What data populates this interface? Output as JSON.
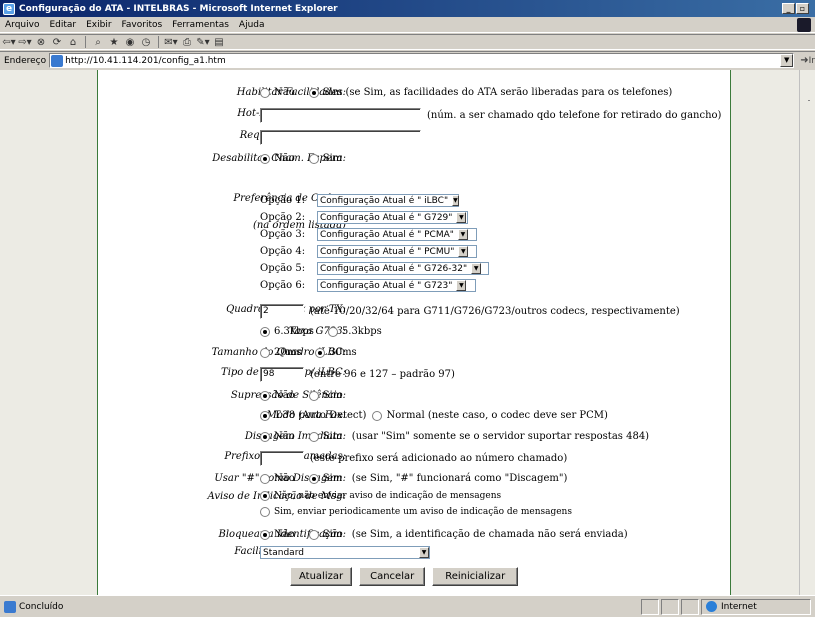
{
  "window": {
    "title": "Configuração do ATA - INTELBRAS - Microsoft Internet Explorer",
    "minimize": "_",
    "maximize": "▫"
  },
  "menu": [
    "Arquivo",
    "Editar",
    "Exibir",
    "Favoritos",
    "Ferramentas",
    "Ajuda"
  ],
  "address": {
    "label": "Endereço",
    "url": "http://10.41.114.201/config_a1.htm",
    "go": "Ir"
  },
  "form": {
    "habilitar_facilidades": {
      "label": "Habilitar Facilidades:",
      "opt_no": "Não",
      "opt_yes": "Sim (se Sim, as facilidades do ATA serão liberadas para os telefones)",
      "selected": "yes"
    },
    "hotline": {
      "label": "Hot-Line Imediato p/:",
      "value": "",
      "note": "(núm. a ser chamado qdo telefone for retirado do gancho)"
    },
    "proxy": {
      "label": "Requisição de Proxy:",
      "value": ""
    },
    "desabilitar_espera": {
      "label": "Desabilitar Cham. Espera:",
      "opt_no": "Não",
      "opt_yes": "Sim",
      "selected": "no"
    },
    "codec": {
      "label": "Preferência de Codec:",
      "sublabel": "(na ordem listada)",
      "options": [
        {
          "label": "Opção 1:",
          "value": "Configuração Atual é \" iLBC\""
        },
        {
          "label": "Opção 2:",
          "value": "Configuração Atual é \" G729\""
        },
        {
          "label": "Opção 3:",
          "value": "Configuração Atual é \" PCMA\""
        },
        {
          "label": "Opção 4:",
          "value": "Configuração Atual é \" PCMU\""
        },
        {
          "label": "Opção 5:",
          "value": "Configuração Atual é \" G726-32\""
        },
        {
          "label": "Opção 6:",
          "value": "Configuração Atual é \" G723\""
        }
      ]
    },
    "quadros_voz": {
      "label": "Quadros de Voz por TX:",
      "value": "2",
      "note": "(até 10/20/32/64 para G711/G726/G723/outros codecs, respectivamente)"
    },
    "taxa_g723": {
      "label": "Taxa G723:",
      "opt_a": "6.3kbps",
      "opt_b": "5.3kbps",
      "selected": "a"
    },
    "quadro_ilbc": {
      "label": "Tamanho do Quadro iLBC:",
      "opt_a": "20ms",
      "opt_b": "30ms",
      "selected": "b"
    },
    "payload_ilbc": {
      "label": "Tipo de Payload p/ iLBC:",
      "value": "98",
      "note": "(entre 96 e 127 – padrão 97)"
    },
    "supressao": {
      "label": "Supressão de Silêncio:",
      "opt_no": "Não",
      "opt_yes": "Sim",
      "selected": "no"
    },
    "modo_fax": {
      "label": "Modo para Fax:",
      "opt_a": "T.38 (Auto Detect)",
      "opt_b": "Normal (neste caso, o codec deve ser PCM)",
      "selected": "a"
    },
    "discagem_imediata": {
      "label": "Discagem Imediata:",
      "opt_no": "Não",
      "opt_yes": "Sim   (usar \"Sim\" somente se o servidor suportar respostas 484)",
      "selected": "no"
    },
    "prefixo": {
      "label": "Prefixo para Chamadas:",
      "value": "",
      "note": "(este prefixo será adicionado ao número chamado)"
    },
    "usar_hash": {
      "label": "Usar \"#\" como Discagem:",
      "opt_no": "Não",
      "opt_yes": "Sim   (se Sim, \"#\" funcionará como \"Discagem\")",
      "selected": "yes"
    },
    "aviso_msg": {
      "label": "Aviso de Indicação de Msg:",
      "opt_a": "Não, não enviar aviso de indicação de mensagens",
      "opt_b": "Sim, enviar periodicamente um aviso de indicação de mensagens",
      "selected": "a"
    },
    "bloquear_id": {
      "label": "Bloquear a Identificação:",
      "opt_no": "Não",
      "opt_yes": "Sim   (se Sim, a identificação de chamada não será enviada)",
      "selected": "no"
    },
    "facilidades_especiais": {
      "label": "Facilidades Especiais:",
      "value": "Standard"
    },
    "buttons": {
      "atualizar": "Atualizar",
      "cancelar": "Cancelar",
      "reinicializar": "Reinicializar"
    }
  },
  "status": {
    "text": "Concluído",
    "zone": "Internet"
  }
}
